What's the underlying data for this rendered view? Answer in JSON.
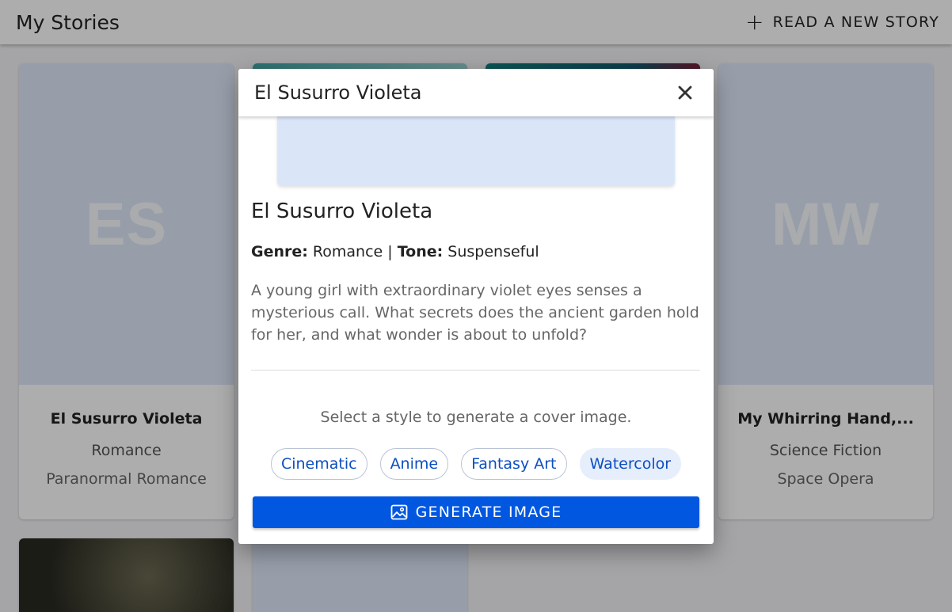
{
  "appbar": {
    "title": "My Stories",
    "new_story_label": "READ A NEW STORY",
    "plus_icon": "+"
  },
  "cards": [
    {
      "initials": "ES",
      "title": "El Susurro Violeta",
      "genre": "Romance",
      "subgenre": "Paranormal Romance"
    },
    {
      "initials": "MW",
      "title": "My Whirring Hand,...",
      "genre": "Science Fiction",
      "subgenre": "Space Opera"
    }
  ],
  "dialog": {
    "header_title": "El Susurro Violeta",
    "story_title": "El Susurro Violeta",
    "genre_label": "Genre:",
    "genre_value": "Romance",
    "separator": "|",
    "tone_label": "Tone:",
    "tone_value": "Suspenseful",
    "description": "A young girl with extraordinary violet eyes senses a mysterious call. What secrets does the ancient garden hold for her, and what wonder is about to unfold?",
    "style_prompt": "Select a style to generate a cover image.",
    "styles": [
      {
        "label": "Cinematic",
        "selected": false
      },
      {
        "label": "Anime",
        "selected": false
      },
      {
        "label": "Fantasy Art",
        "selected": false
      },
      {
        "label": "Watercolor",
        "selected": true
      }
    ],
    "generate_label": "GENERATE IMAGE"
  },
  "colors": {
    "accent": "#0157e0",
    "chip_text": "#0b4fc1",
    "chip_selected_bg": "#e6eefc",
    "overlay": "rgba(0,0,0,0.32)"
  }
}
